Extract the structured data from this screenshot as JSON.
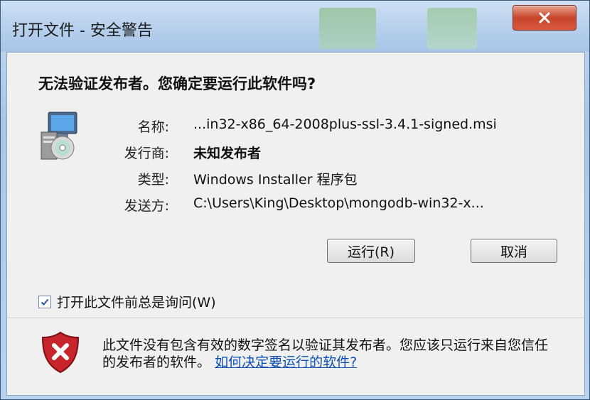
{
  "window": {
    "title": "打开文件 - 安全警告",
    "close_icon": "close-icon"
  },
  "dialog": {
    "question": "无法验证发布者。您确定要运行此软件吗?",
    "app_icon": "windows-installer-icon",
    "fields": [
      {
        "label": "名称:",
        "value": "...in32-x86_64-2008plus-ssl-3.4.1-signed.msi",
        "bold": false
      },
      {
        "label": "发行商:",
        "value": "未知发布者",
        "bold": true
      },
      {
        "label": "类型:",
        "value": "Windows Installer 程序包",
        "bold": false
      },
      {
        "label": "发送方:",
        "value": "C:\\Users\\King\\Desktop\\mongodb-win32-x...",
        "bold": false
      }
    ],
    "run_button": "运行(R)",
    "cancel_button": "取消",
    "checkbox": {
      "label": "打开此文件前总是询问(W)",
      "checked": true
    }
  },
  "footer": {
    "shield_icon": "security-warning-shield-icon",
    "text": "此文件没有包含有效的数字签名以验证其发布者。您应该只运行来自您信任的发布者的软件。",
    "link": "如何决定要运行的软件?"
  },
  "colors": {
    "link": "#0b4fb3",
    "shield_red": "#c8242b",
    "titlebar": "#b6cfec"
  }
}
